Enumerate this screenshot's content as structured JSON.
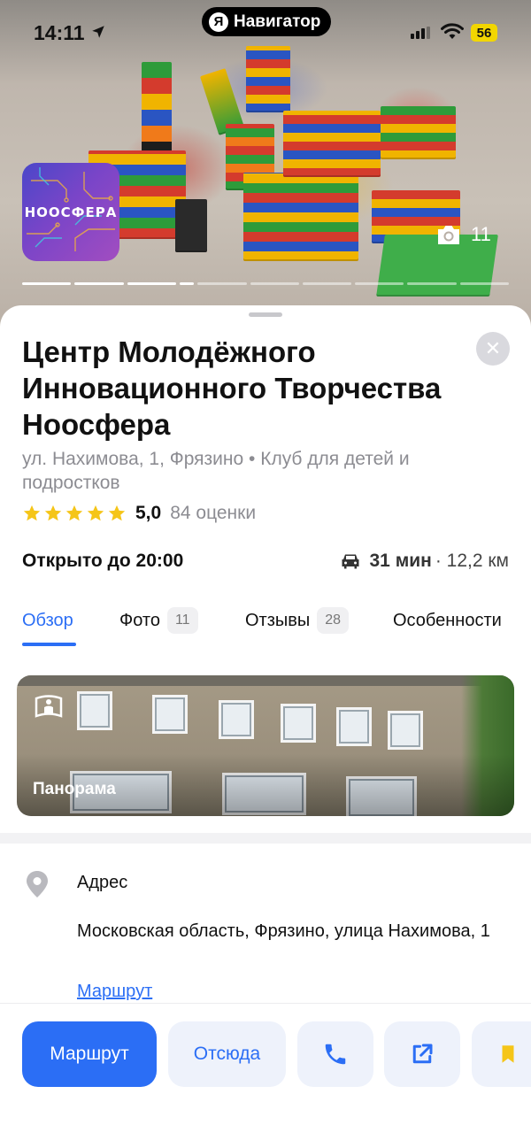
{
  "status_bar": {
    "time": "14:11",
    "app_pill": {
      "logo": "Я",
      "label": "Навигатор"
    },
    "battery": "56"
  },
  "hero": {
    "logo_text": "НООСФЕРА",
    "photo_count": "11",
    "carousel_total": 10,
    "carousel_active_index": 3
  },
  "place": {
    "title": "Центр Молодёжного Инновационного Творчества Ноосфера",
    "subtitle": "ул. Нахимова, 1, Фрязино • Клуб для детей и подростков",
    "rating_value": "5,0",
    "rating_count": "84 оценки",
    "stars_filled": 5,
    "hours": "Открыто до 20:00",
    "drive_time": "31 мин",
    "drive_distance": "· 12,2 км"
  },
  "tabs": [
    {
      "label": "Обзор",
      "badge": ""
    },
    {
      "label": "Фото",
      "badge": "11"
    },
    {
      "label": "Отзывы",
      "badge": "28"
    },
    {
      "label": "Особенности",
      "badge": ""
    }
  ],
  "panorama": {
    "label": "Панорама"
  },
  "address": {
    "heading": "Адрес",
    "text": "Московская область, Фрязино, улица Нахимова, 1",
    "route_link": "Маршрут"
  },
  "actions": {
    "route": "Маршрут",
    "from_here": "Отсюда"
  },
  "colors": {
    "accent": "#2b6ef5",
    "star": "#f5c518",
    "secondary_button_bg": "#eef2fb",
    "bookmark": "#f5c518"
  },
  "icons": [
    "location-arrow-icon",
    "cellular-signal-icon",
    "wifi-icon",
    "camera-icon",
    "close-icon",
    "star-icon",
    "car-icon",
    "panorama-icon",
    "map-pin-icon",
    "phone-icon",
    "share-icon",
    "bookmark-icon"
  ]
}
